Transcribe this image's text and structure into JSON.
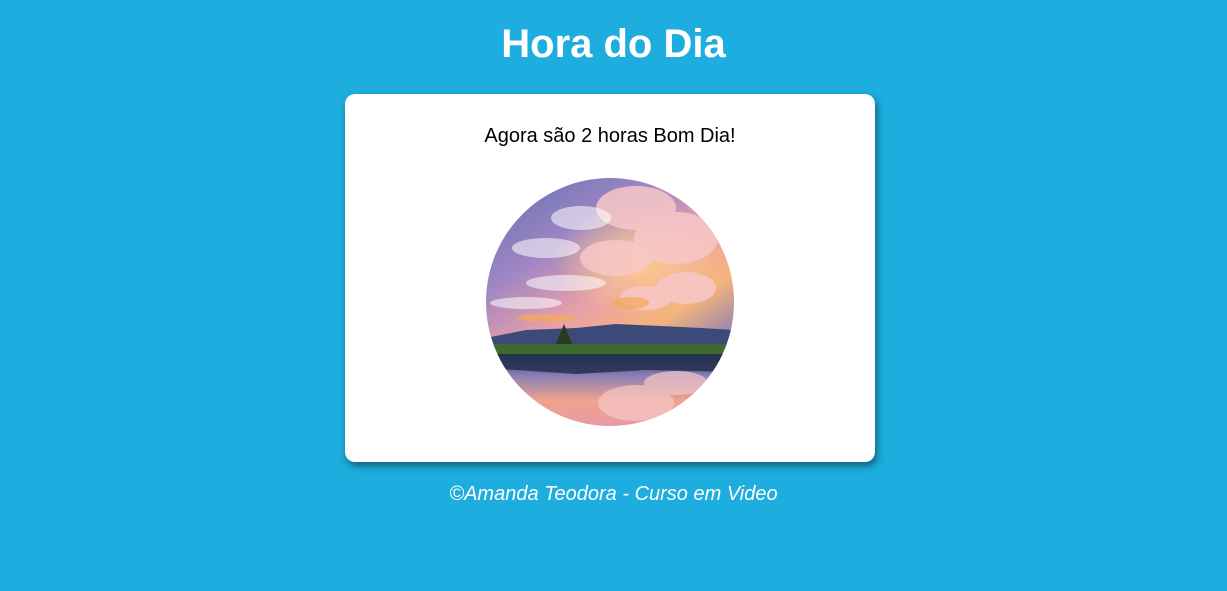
{
  "header": {
    "title": "Hora do Dia"
  },
  "card": {
    "message": "Agora são 2 horas Bom Dia!",
    "image": {
      "subject": "morning sky reflected in a lake",
      "shape": "circle"
    }
  },
  "footer": {
    "text": "©Amanda Teodora - Curso em Video"
  },
  "colors": {
    "background": "#1dadde",
    "card": "#ffffff",
    "title": "#ffffff",
    "message": "#000000",
    "footer": "#ffffff"
  }
}
